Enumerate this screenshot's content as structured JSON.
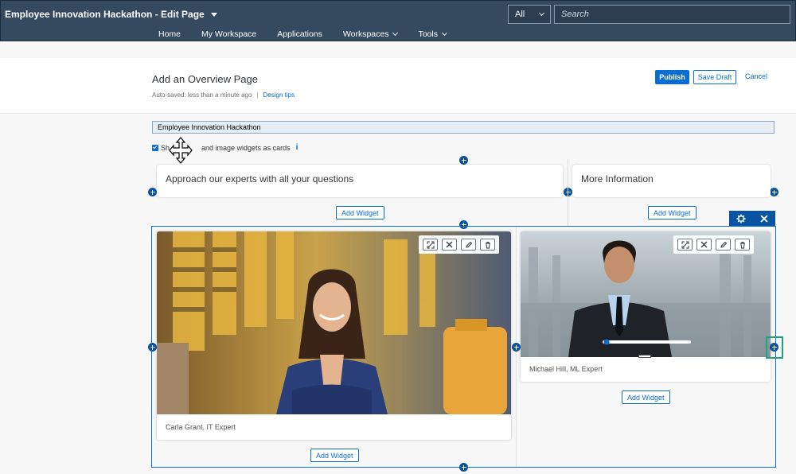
{
  "shell": {
    "app_title": "Employee Innovation Hackathon - Edit Page",
    "scope_value": "All",
    "search_placeholder": "Search",
    "nav": [
      "Home",
      "My Workspace",
      "Applications",
      "Workspaces",
      "Tools"
    ]
  },
  "header": {
    "title": "Add an Overview Page",
    "autosave": "Auto-saved: less than a minute ago",
    "separator": "|",
    "design_tips": "Design tips",
    "publish": "Publish",
    "save_draft": "Save Draft",
    "cancel": "Cancel"
  },
  "editor": {
    "page_name": "Employee Innovation Hackathon",
    "checkbox_label": "Show text and image widgets as cards",
    "checkbox_prefix": "Sh",
    "checkbox_suffix": "and image widgets as cards",
    "checkbox_checked": true,
    "info_glyph": "i"
  },
  "top_row": {
    "left_title": "Approach our experts with all your questions",
    "right_title": "More Information",
    "add_widget": "Add Widget"
  },
  "section": {
    "cards": [
      {
        "caption": "Carla Grant, IT Expert",
        "image": "woman-smiling-photo"
      },
      {
        "caption": "Michael Hill, ML Expert",
        "image": "man-in-suit-photo"
      }
    ],
    "add_widget": "Add Widget",
    "slider_level": 0.02
  },
  "colors": {
    "shell": "#354a5f",
    "accent": "#0a6ed1",
    "handle": "#0854a0",
    "focus": "#20a37a"
  },
  "icons": [
    "caret-down-icon",
    "chevron-down-icon",
    "plus-icon",
    "gear-icon",
    "close-icon",
    "expand-icon",
    "edit-icon",
    "delete-icon",
    "move-cursor-icon",
    "info-icon"
  ]
}
